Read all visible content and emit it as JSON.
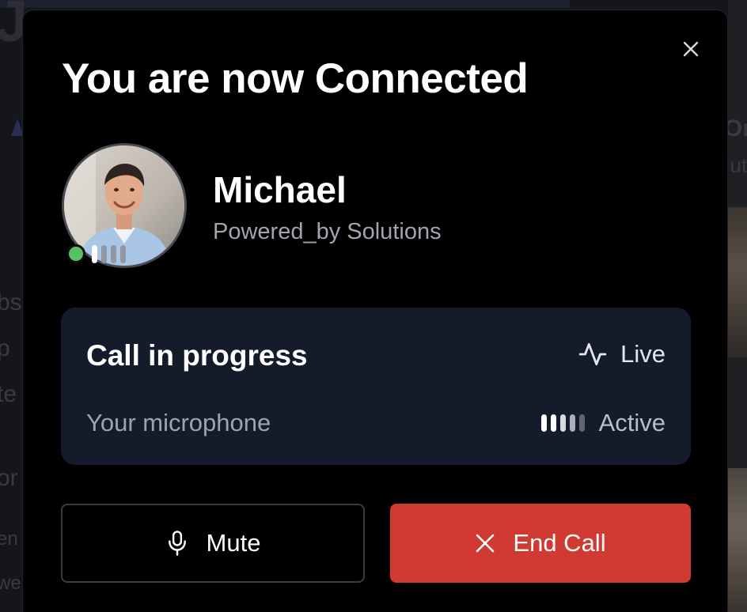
{
  "background": {
    "left_fragments": [
      "bs",
      "p",
      "te",
      "or",
      "en",
      "we"
    ],
    "right_fragments": [
      "Or",
      "uti"
    ]
  },
  "modal": {
    "title": "You are now Connected",
    "close_icon": "close-icon"
  },
  "contact": {
    "name": "Michael",
    "company": "Powered_by Solutions",
    "status": "online",
    "status_color": "#5bbf63"
  },
  "call": {
    "title": "Call in progress",
    "live_icon": "activity-pulse-icon",
    "live_label": "Live",
    "microphone_label": "Your microphone",
    "microphone_status": "Active",
    "microphone_level_bars": 5
  },
  "actions": {
    "mute_label": "Mute",
    "mute_icon": "microphone-icon",
    "end_label": "End Call",
    "end_icon": "close-icon",
    "end_color": "#d03a33"
  }
}
